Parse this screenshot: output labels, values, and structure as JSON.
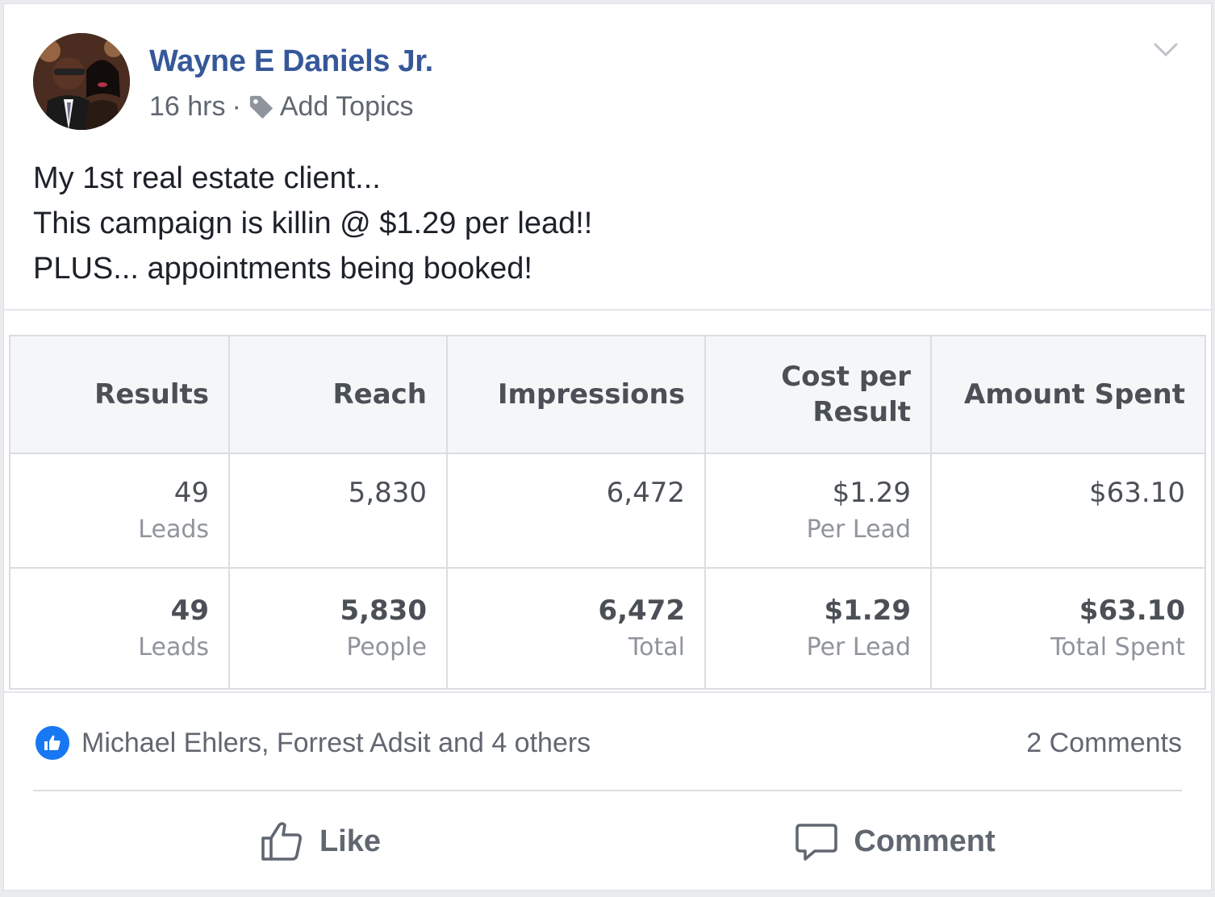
{
  "post": {
    "author": "Wayne E Daniels Jr.",
    "time": "16 hrs",
    "separator": "·",
    "add_topics": "Add Topics",
    "lines": [
      "My 1st real estate client...",
      "This campaign is killin @ $1.29 per lead!!",
      "PLUS... appointments being booked!"
    ]
  },
  "ads_table": {
    "headers": [
      "Results",
      "Reach",
      "Impressions",
      "Cost per Result",
      "Amount Spent"
    ],
    "rows": [
      {
        "results": {
          "value": "49",
          "sub": "Leads"
        },
        "reach": {
          "value": "5,830",
          "sub": ""
        },
        "impressions": {
          "value": "6,472",
          "sub": ""
        },
        "cost": {
          "value": "$1.29",
          "sub": "Per Lead"
        },
        "spent": {
          "value": "$63.10",
          "sub": ""
        }
      },
      {
        "results": {
          "value": "49",
          "sub": "Leads"
        },
        "reach": {
          "value": "5,830",
          "sub": "People"
        },
        "impressions": {
          "value": "6,472",
          "sub": "Total"
        },
        "cost": {
          "value": "$1.29",
          "sub": "Per Lead"
        },
        "spent": {
          "value": "$63.10",
          "sub": "Total Spent"
        }
      }
    ]
  },
  "reactions": {
    "names": "Michael Ehlers, Forrest Adsit and 4 others",
    "comments": "2 Comments"
  },
  "actions": {
    "like": "Like",
    "comment": "Comment"
  },
  "colors": {
    "author": "#365899",
    "like_badge": "#1877f2",
    "muted": "#616770"
  },
  "icons": [
    "chevron-down-icon",
    "tag-icon",
    "like-badge-icon",
    "thumbs-up-icon",
    "comment-bubble-icon"
  ]
}
